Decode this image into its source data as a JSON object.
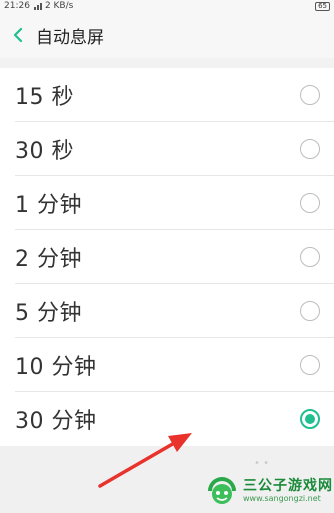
{
  "status_bar": {
    "time": "21:26",
    "speed": "2 KB/s",
    "battery": "65"
  },
  "header": {
    "title": "自动息屏",
    "back_icon": "chevron-left-icon",
    "accent_color": "#1fbf8f"
  },
  "options": [
    {
      "label": "15 秒",
      "selected": false
    },
    {
      "label": "30 秒",
      "selected": false
    },
    {
      "label": "1 分钟",
      "selected": false
    },
    {
      "label": "2 分钟",
      "selected": false
    },
    {
      "label": "5 分钟",
      "selected": false
    },
    {
      "label": "10 分钟",
      "selected": false
    },
    {
      "label": "30 分钟",
      "selected": true
    }
  ],
  "watermark": {
    "title": "三公子游戏网",
    "url": "www.sangongzi.net"
  }
}
